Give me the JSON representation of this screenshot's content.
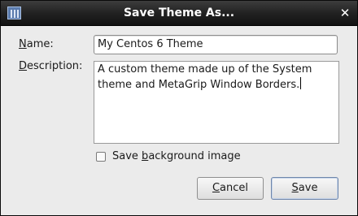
{
  "window": {
    "title": "Save Theme As..."
  },
  "form": {
    "name_label": {
      "mnemonic": "N",
      "rest": "ame:"
    },
    "name_value": "My Centos 6 Theme",
    "description_label": {
      "mnemonic": "D",
      "rest": "escription:"
    },
    "description_value": "A custom theme made up of the System theme and MetaGrip Window Borders.",
    "save_background": {
      "pre": "Save ",
      "mnemonic": "b",
      "post": "ackground image",
      "checked": false
    }
  },
  "buttons": {
    "cancel": {
      "mnemonic": "C",
      "rest": "ancel"
    },
    "save": {
      "mnemonic": "S",
      "rest": "ave"
    }
  },
  "icons": {
    "app": "theme-app-icon",
    "close": "close-icon"
  }
}
